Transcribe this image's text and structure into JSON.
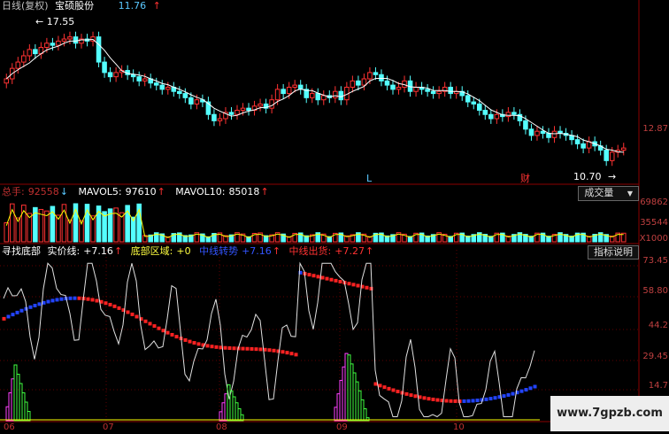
{
  "header": {
    "period": "日线(复权)",
    "stock_name": "宝硕股份",
    "last_price": "11.76",
    "up_arrow": "↑"
  },
  "main_panel": {
    "high_label": "17.55",
    "low_label": "10.70",
    "axis_top_label": "12.87",
    "marker_L": "L",
    "marker_cai": "财"
  },
  "volume_panel": {
    "total_label": "总手:",
    "total_value": "92558",
    "total_arrow": "↓",
    "mavol5_label": "MAVOL5:",
    "mavol5_value": "97610",
    "mavol5_arrow": "↑",
    "mavol10_label": "MAVOL10:",
    "mavol10_value": "85018",
    "mavol10_arrow": "↑",
    "dropdown_label": "成交量",
    "dropdown_arrow": "▼",
    "axis_labels": [
      "69862",
      "35544",
      "X1000"
    ]
  },
  "indicator_panel": {
    "name": "寻找底部",
    "line1_label": "实价线:",
    "line1_value": "+7.16",
    "line1_arrow": "↑",
    "line2_label": "底部区域:",
    "line2_value": "+0",
    "line3_label": "中线转势",
    "line3_value": "+7.16",
    "line3_arrow": "↑",
    "line4_label": "中线出货:",
    "line4_value": "+7.27",
    "line4_arrow": "↑",
    "help_button": "指标说明",
    "axis_labels": [
      "73.45",
      "58.80",
      "44.2",
      "29.45",
      "14.7"
    ]
  },
  "x_axis_labels": [
    "06",
    "07",
    "08",
    "09",
    "10"
  ],
  "watermark": "www.7gpzb.com",
  "colors": {
    "up": "#ff3232",
    "down": "#54ffff",
    "ma": "#ffffff",
    "vol_line": "#ffff00",
    "blue_dot": "#2244ff",
    "red_dot": "#ff2222",
    "magenta": "#ff40ff",
    "green": "#40ff40"
  },
  "chart_data": {
    "type": "candlestick",
    "price_range": [
      10.0,
      17.9
    ],
    "candles_close": [
      14.9,
      15.4,
      15.7,
      16.0,
      16.3,
      16.1,
      16.4,
      16.6,
      16.5,
      16.7,
      16.8,
      16.9,
      16.6,
      16.8,
      16.7,
      16.9,
      15.7,
      15.2,
      15.0,
      15.2,
      15.3,
      15.1,
      15.0,
      14.8,
      14.9,
      14.7,
      14.6,
      14.4,
      14.5,
      14.3,
      14.2,
      14.0,
      13.7,
      13.9,
      13.8,
      13.2,
      12.9,
      13.0,
      13.3,
      13.2,
      13.4,
      13.5,
      13.4,
      13.6,
      13.7,
      13.5,
      13.9,
      14.4,
      14.2,
      14.5,
      14.6,
      14.4,
      14.0,
      14.2,
      13.9,
      14.1,
      14.0,
      14.3,
      13.9,
      14.5,
      14.8,
      14.6,
      14.9,
      15.2,
      15.1,
      14.8,
      14.6,
      14.4,
      14.5,
      14.8,
      14.3,
      14.5,
      14.4,
      14.3,
      14.2,
      14.3,
      14.5,
      14.2,
      14.3,
      14.1,
      13.8,
      13.7,
      13.4,
      13.2,
      13.0,
      13.2,
      13.1,
      13.3,
      13.2,
      12.9,
      12.5,
      12.2,
      12.4,
      12.3,
      12.1,
      12.4,
      12.3,
      12.2,
      12.0,
      11.8,
      11.6,
      11.9,
      11.7,
      11.5,
      11.0,
      11.4,
      11.5,
      11.6
    ]
  }
}
